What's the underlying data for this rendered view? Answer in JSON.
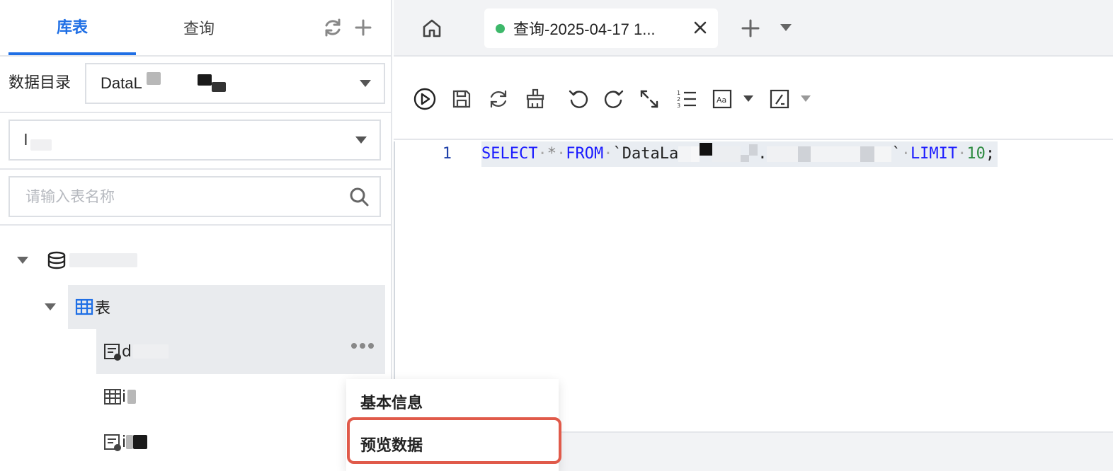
{
  "left_panel": {
    "tabs": [
      {
        "label": "库表",
        "active": true
      },
      {
        "label": "查询",
        "active": false
      }
    ],
    "icons": [
      "refresh-icon",
      "plus-icon"
    ],
    "catalog": {
      "label": "数据目录",
      "value": "DataL"
    },
    "database": {
      "value": "l"
    },
    "search": {
      "placeholder": "请输入表名称",
      "value": ""
    },
    "tree": {
      "table_group_label": "表",
      "items": [
        {
          "prefix": "d",
          "icon": "view-table-icon",
          "selected": true
        },
        {
          "prefix": "i",
          "icon": "table-icon",
          "selected": false
        },
        {
          "prefix": "i",
          "icon": "view-table-icon",
          "selected": false
        }
      ]
    }
  },
  "topbar": {
    "home_icon": "home-icon",
    "query_tab": {
      "title": "查询-2025-04-17 1...",
      "status_color": "#3db86a"
    }
  },
  "toolbar": {
    "icons": [
      "run-icon",
      "save-icon",
      "refresh-icon",
      "format-brush-icon",
      "undo-icon",
      "redo-icon",
      "expand-icon",
      "list-numbered-icon",
      "font-size-icon",
      "code-block-icon"
    ]
  },
  "editor": {
    "line_number": "1",
    "code": {
      "kw_select": "SELECT",
      "star": "*",
      "kw_from": "FROM",
      "table_start": "`DataLa",
      "table_dot": ".",
      "table_end": "`",
      "kw_limit": "LIMIT",
      "limit_value": "10",
      "end": ";"
    }
  },
  "context_menu": {
    "items": [
      "基本信息",
      "预览数据"
    ],
    "highlight_color": "#e05a4a"
  },
  "colors": {
    "accent": "#1f6fe5",
    "border": "#e4e6ea"
  }
}
